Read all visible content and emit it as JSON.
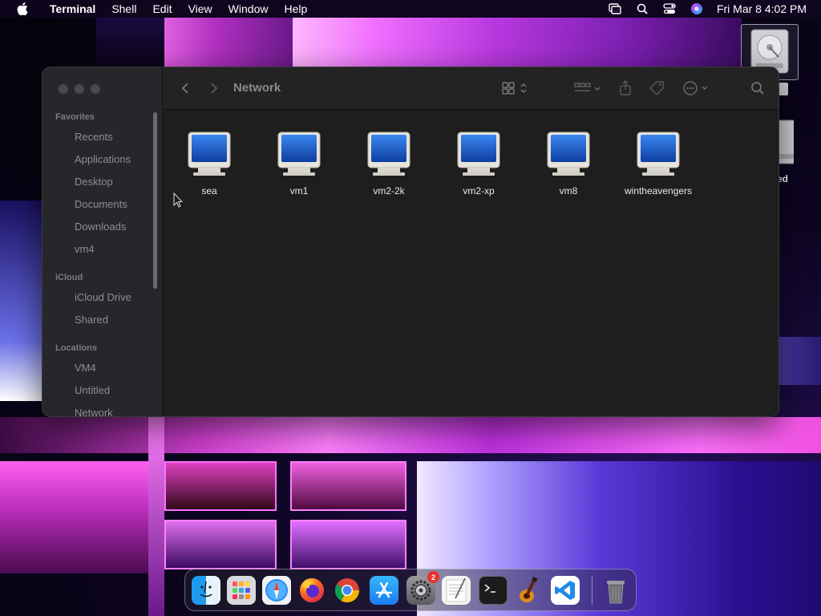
{
  "menubar": {
    "app_name": "Terminal",
    "items": [
      "Shell",
      "Edit",
      "View",
      "Window",
      "Help"
    ],
    "clock": "Fri Mar 8  4:02 PM"
  },
  "finder": {
    "title": "Network",
    "sidebar": {
      "favorites_header": "Favorites",
      "favorites": [
        "Recents",
        "Applications",
        "Desktop",
        "Documents",
        "Downloads",
        "vm4"
      ],
      "icloud_header": "iCloud",
      "icloud": [
        "iCloud Drive",
        "Shared"
      ],
      "locations_header": "Locations",
      "locations": [
        "VM4",
        "Untitled",
        "Network"
      ]
    },
    "network_items": [
      "sea",
      "vm1",
      "vm2-2k",
      "vm2-xp",
      "vm8",
      "wintheavengers"
    ]
  },
  "desktop": {
    "partial_label": "ed"
  },
  "dock": {
    "apps": [
      "finder-icon",
      "launchpad-icon",
      "safari-icon",
      "firefox-icon",
      "chrome-icon",
      "app-store-icon",
      "system-settings-icon",
      "textedit-icon",
      "terminal-icon",
      "garageband-icon",
      "vscode-icon",
      "trash-icon"
    ],
    "settings_badge": "2"
  }
}
